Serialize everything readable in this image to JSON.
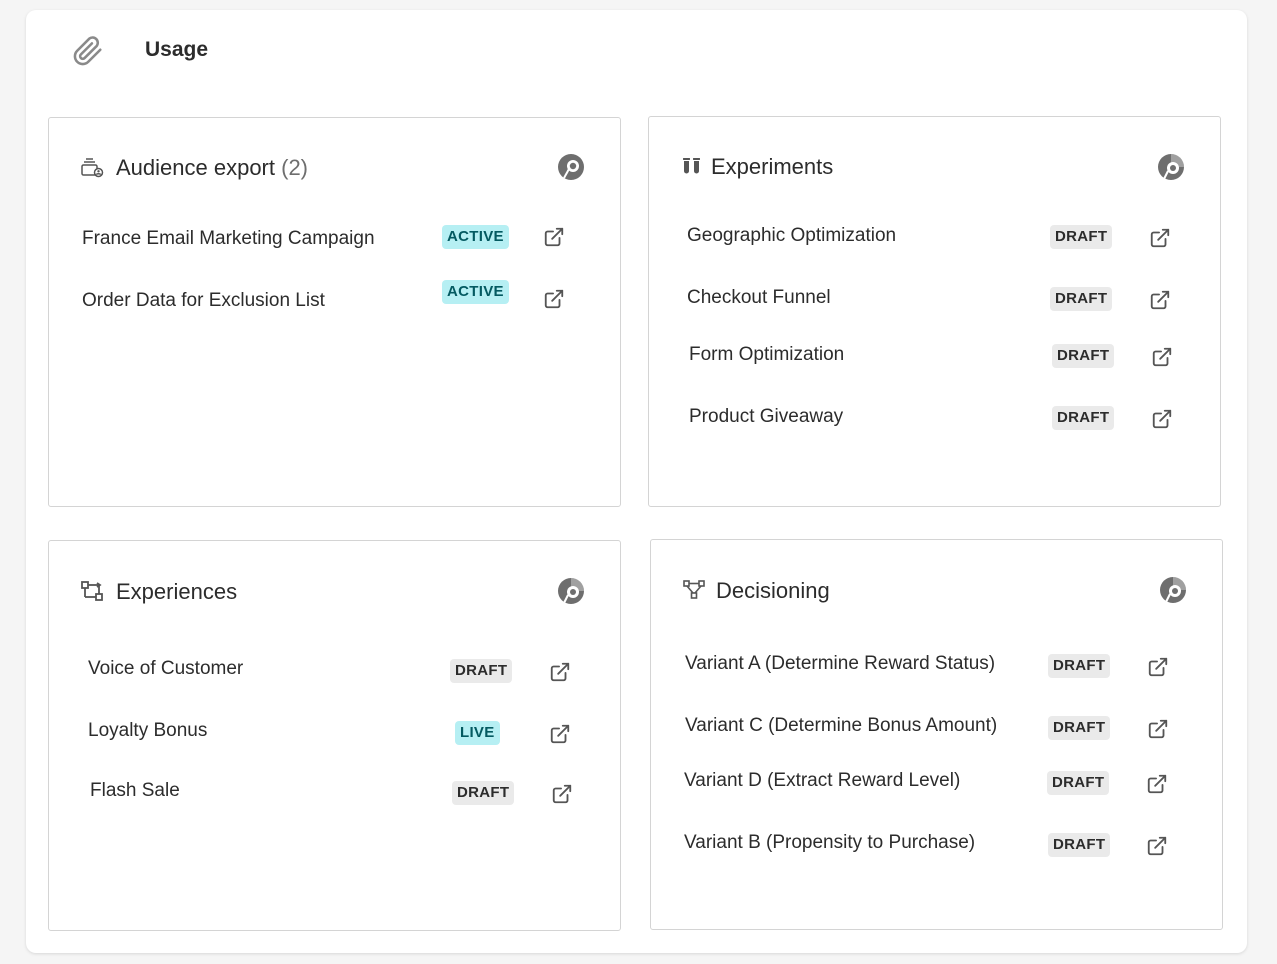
{
  "header": {
    "title": "Usage",
    "icon": "paperclip-icon"
  },
  "colors": {
    "badge_draft_bg": "#eaeaea",
    "badge_active_bg": "#b6eff3",
    "badge_active_text": "#045a61",
    "icon_gray": "#6e6e6e"
  },
  "audience": {
    "title": "Audience export",
    "count": "(2)",
    "items": [
      {
        "label": "France Email Marketing Campaign",
        "status": "ACTIVE"
      },
      {
        "label": "Order Data for Exclusion List",
        "status": "ACTIVE"
      }
    ]
  },
  "experiments": {
    "title": "Experiments",
    "items": [
      {
        "label": "Geographic Optimization",
        "status": "DRAFT"
      },
      {
        "label": "Checkout Funnel",
        "status": "DRAFT"
      },
      {
        "label": "Form Optimization",
        "status": "DRAFT"
      },
      {
        "label": "Product Giveaway",
        "status": "DRAFT"
      }
    ]
  },
  "experiences": {
    "title": "Experiences",
    "items": [
      {
        "label": "Voice of Customer",
        "status": "DRAFT"
      },
      {
        "label": "Loyalty Bonus",
        "status": "LIVE"
      },
      {
        "label": "Flash Sale",
        "status": "DRAFT"
      }
    ]
  },
  "decisioning": {
    "title": "Decisioning",
    "items": [
      {
        "label": "Variant A (Determine Reward Status)",
        "status": "DRAFT"
      },
      {
        "label": "Variant C (Determine Bonus Amount)",
        "status": "DRAFT"
      },
      {
        "label": "Variant D (Extract Reward Level)",
        "status": "DRAFT"
      },
      {
        "label": "Variant B (Propensity to Purchase)",
        "status": "DRAFT"
      }
    ]
  }
}
